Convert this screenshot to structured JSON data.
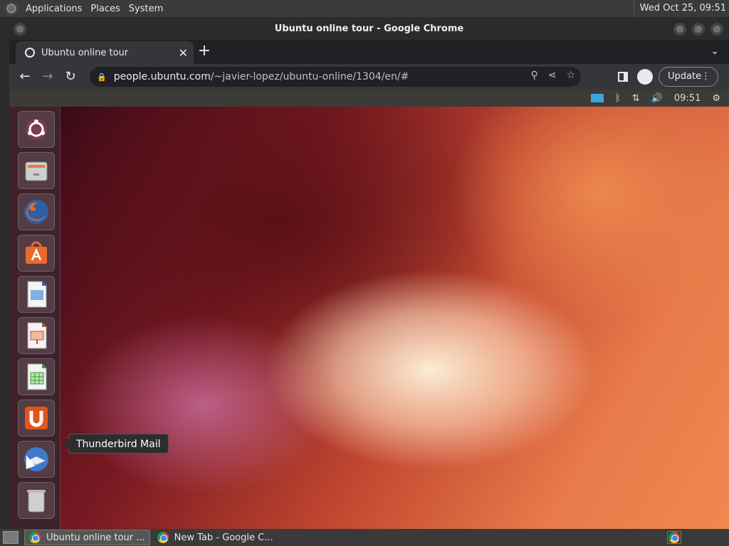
{
  "top_panel": {
    "menus": [
      "Applications",
      "Places",
      "System"
    ],
    "clock": "Wed Oct 25, 09:51"
  },
  "window": {
    "title": "Ubuntu online tour - Google Chrome"
  },
  "tab": {
    "title": "Ubuntu online tour"
  },
  "address_bar": {
    "host": "people.ubuntu.com",
    "path": "/~javier-lopez/ubuntu-online/1304/en/#"
  },
  "toolbar": {
    "update_label": "Update"
  },
  "ubuntu_panel": {
    "time": "09:51"
  },
  "launcher": {
    "items": [
      {
        "icon": "dash-home-icon"
      },
      {
        "icon": "files-icon"
      },
      {
        "icon": "firefox-icon"
      },
      {
        "icon": "software-center-icon"
      },
      {
        "icon": "libreoffice-writer-icon"
      },
      {
        "icon": "libreoffice-impress-icon"
      },
      {
        "icon": "libreoffice-calc-icon"
      },
      {
        "icon": "ubuntu-one-icon"
      },
      {
        "icon": "thunderbird-icon"
      },
      {
        "icon": "trash-icon"
      }
    ],
    "tooltip": "Thunderbird Mail"
  },
  "taskbar": {
    "tasks": [
      "Ubuntu online tour ...",
      "New Tab - Google C..."
    ]
  }
}
